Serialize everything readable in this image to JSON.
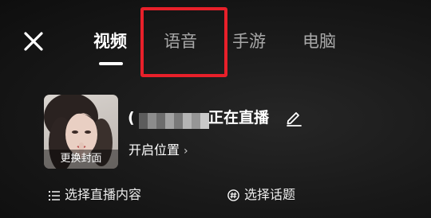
{
  "tabs": [
    {
      "label": "视频",
      "active": true
    },
    {
      "label": "语音",
      "active": false
    },
    {
      "label": "手游",
      "active": false
    },
    {
      "label": "电脑",
      "active": false
    }
  ],
  "cover": {
    "label": "更换封面"
  },
  "live_title": {
    "prefix": "(",
    "suffix": "正在直播"
  },
  "location": {
    "label": "开启位置",
    "chevron": "›"
  },
  "options": {
    "content": "选择直播内容",
    "topic": "选择话题"
  },
  "icons": [
    "close-icon",
    "edit-pencil-icon",
    "list-icon",
    "hashtag-icon"
  ],
  "colors": {
    "highlight": "#e8202a",
    "background": "#161616",
    "text": "#ffffff"
  }
}
